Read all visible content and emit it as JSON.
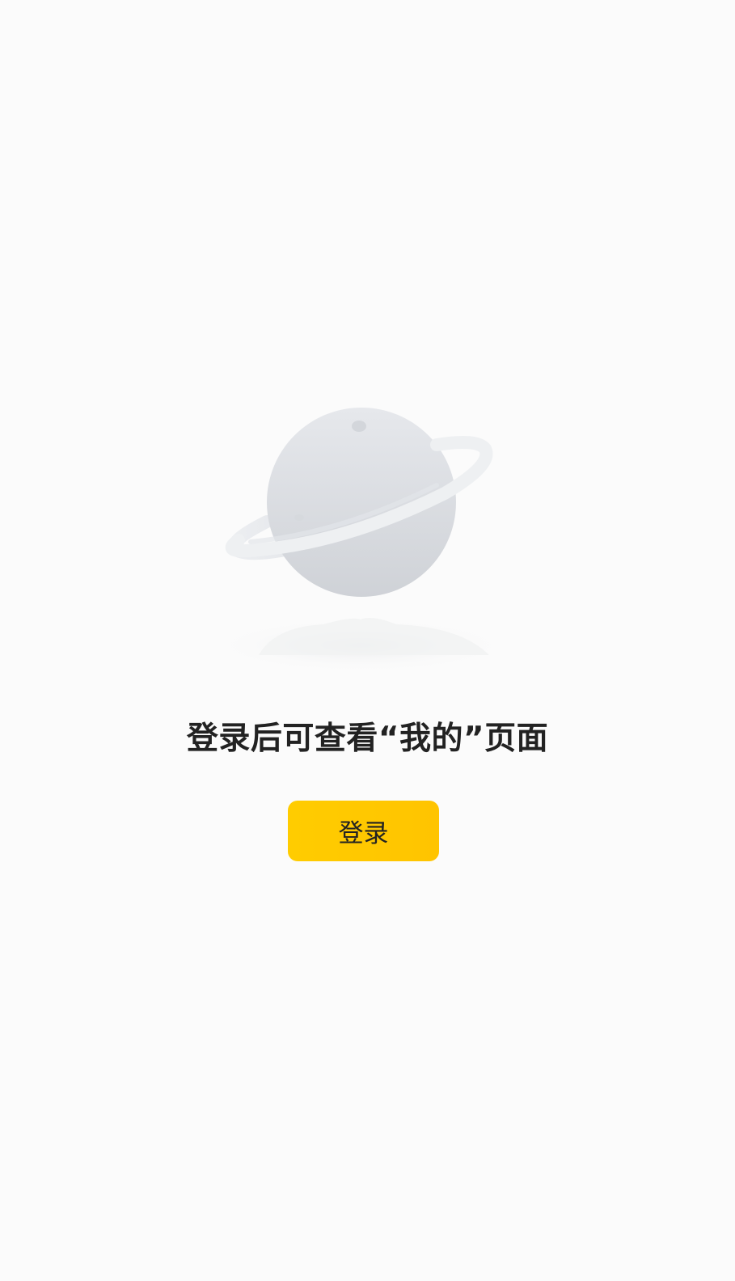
{
  "empty_state": {
    "illustration": "planet-icon",
    "message": "登录后可查看“我的”页面",
    "login_button_label": "登录"
  },
  "colors": {
    "background": "#fbfbfb",
    "accent": "#ffcc00",
    "text": "#222222",
    "planet": "#dfe1e5"
  }
}
